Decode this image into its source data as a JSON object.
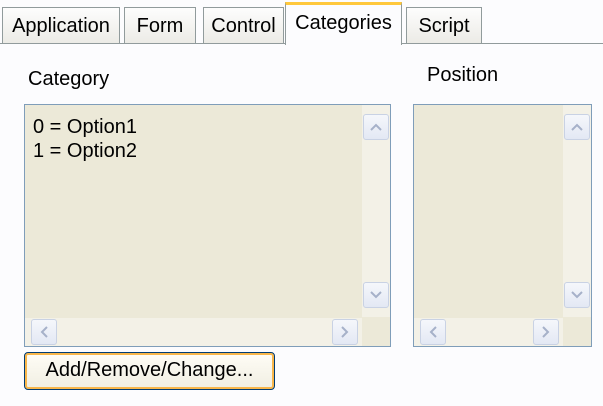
{
  "tabs": [
    {
      "label": "Application"
    },
    {
      "label": "Form"
    },
    {
      "label": "Control"
    },
    {
      "label": "Categories",
      "active": true
    },
    {
      "label": "Script"
    }
  ],
  "category": {
    "label": "Category",
    "items": [
      "0 = Option1",
      "1 = Option2"
    ]
  },
  "position": {
    "label": "Position",
    "items": []
  },
  "buttons": {
    "add_remove_change": "Add/Remove/Change..."
  },
  "colors": {
    "active_tab_accent": "#ffc83c",
    "listbox_background": "#ece9d8",
    "listbox_border": "#7f9db9",
    "button_focus": "#f8b64a"
  }
}
